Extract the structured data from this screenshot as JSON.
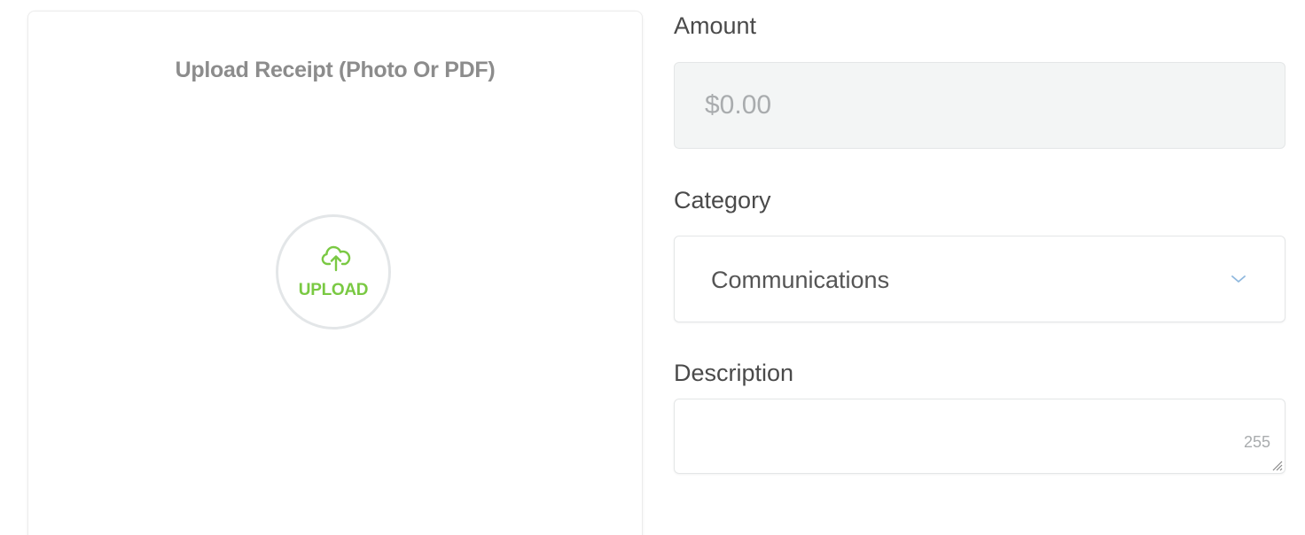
{
  "upload": {
    "title": "Upload Receipt (Photo Or PDF)",
    "button_label": "UPLOAD",
    "icon": "cloud-upload-icon",
    "accent_color": "#7ac943"
  },
  "form": {
    "amount": {
      "label": "Amount",
      "value": "",
      "placeholder": "$0.00"
    },
    "category": {
      "label": "Category",
      "selected": "Communications",
      "icon": "chevron-down-icon"
    },
    "description": {
      "label": "Description",
      "value": "",
      "max_chars": "255"
    }
  }
}
